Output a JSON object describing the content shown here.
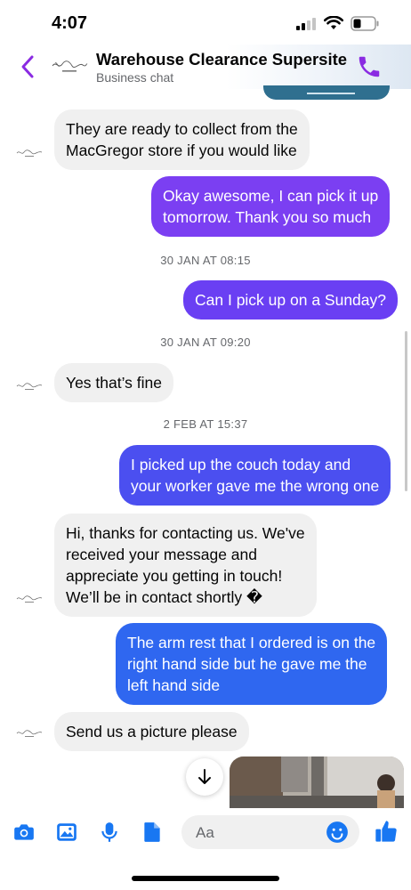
{
  "status_bar": {
    "time": "4:07"
  },
  "header": {
    "title": "Warehouse Clearance Supersite",
    "subtitle": "Business chat"
  },
  "messages": [
    {
      "type": "incoming",
      "lines": [
        "They are ready to collect from the",
        "MacGregor store if you would like"
      ]
    },
    {
      "type": "outgoing",
      "lines": [
        "Okay awesome, I can pick it up",
        "tomorrow. Thank you so much"
      ]
    },
    {
      "type": "timestamp",
      "text": "30 JAN AT 08:15"
    },
    {
      "type": "outgoing",
      "lines": [
        "Can I pick up on a Sunday?"
      ]
    },
    {
      "type": "timestamp",
      "text": "30 JAN AT 09:20"
    },
    {
      "type": "incoming",
      "lines": [
        "Yes that’s fine"
      ]
    },
    {
      "type": "timestamp",
      "text": "2 FEB AT 15:37"
    },
    {
      "type": "outgoing",
      "lines": [
        "I picked up the couch today and",
        "your worker gave me the wrong one"
      ]
    },
    {
      "type": "incoming",
      "lines": [
        "Hi, thanks for contacting us. We've",
        "received your message and",
        "appreciate you getting in touch!",
        "We’ll be in contact shortly �"
      ]
    },
    {
      "type": "outgoing",
      "lines": [
        "The arm rest that I ordered is on the",
        "right hand side but he gave me the",
        "left hand side"
      ]
    },
    {
      "type": "incoming",
      "lines": [
        "Send us a picture please"
      ]
    }
  ],
  "composer": {
    "placeholder": "Aa",
    "icons": [
      "camera-icon",
      "gallery-icon",
      "microphone-icon",
      "document-icon",
      "emoji-icon",
      "thumbs-up-icon"
    ]
  },
  "colors": {
    "accent": "#8a2be2",
    "bubble_purple": "#7b3ff2",
    "bubble_indigo": "#5b42f3",
    "bubble_blue": "#3b5ce6",
    "bubble_blue_last": "#2f67f0",
    "incoming_bg": "#f0f0f0",
    "icon_blue": "#1877f2"
  }
}
